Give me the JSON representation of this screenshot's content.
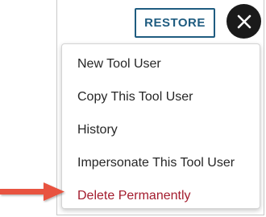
{
  "toolbar": {
    "restore_label": "RESTORE",
    "close_icon": "close-icon"
  },
  "menu": {
    "items": [
      {
        "label": "New Tool User"
      },
      {
        "label": "Copy This Tool User"
      },
      {
        "label": "History"
      },
      {
        "label": "Impersonate This Tool User"
      },
      {
        "label": "Delete Permanently"
      }
    ]
  },
  "annotation": {
    "arrow_icon": "arrow-right-icon"
  },
  "colors": {
    "accent": "#1f5c80",
    "danger": "#a31c2e",
    "close_bg": "#1a1a1a",
    "arrow": "#e8533f"
  }
}
